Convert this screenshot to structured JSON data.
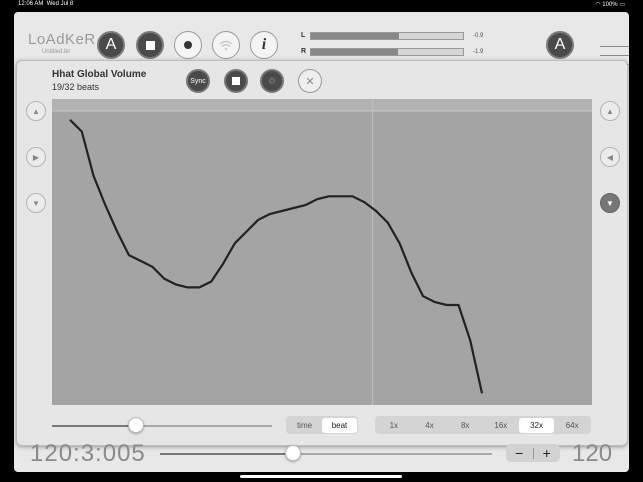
{
  "status_bar": {
    "time": "12:06 AM",
    "date": "Wed Jul 8",
    "battery": "100%"
  },
  "app": {
    "logo": "LoAdKeR",
    "file_name": "Untitled.lkr"
  },
  "toolbar": {
    "a_button": "A",
    "stop_icon": "stop-icon",
    "record_icon": "record-icon",
    "wifi_icon": "wifi-icon",
    "info_label": "i",
    "right_a_button": "A"
  },
  "meters": {
    "left": {
      "label": "L",
      "db": "-0.9",
      "level": 0.58
    },
    "right": {
      "label": "R",
      "db": "-1.9",
      "level": 0.57
    }
  },
  "panel": {
    "title": "Hhat Global Volume",
    "subtitle": "19/32 beats",
    "sync_label": "Sync",
    "stop_icon": "stop-icon",
    "recycle_icon": "recycle-icon",
    "close_icon": "close-icon",
    "left_buttons": [
      "up-arrow-icon",
      "play-arrow-icon",
      "down-arrow-icon"
    ],
    "right_buttons": [
      "up-arrow-icon",
      "left-arrow-icon",
      "down-arrow-icon"
    ]
  },
  "chart_data": {
    "type": "line",
    "x": [
      0,
      1,
      2,
      3,
      4,
      5,
      6,
      7,
      8,
      9,
      10,
      11,
      12,
      13,
      14,
      15,
      16,
      17,
      18,
      19,
      20,
      21,
      22,
      23,
      24,
      25,
      26,
      27,
      28,
      29,
      30,
      31,
      32,
      33,
      34,
      35
    ],
    "y": [
      0.97,
      0.93,
      0.78,
      0.68,
      0.59,
      0.51,
      0.49,
      0.47,
      0.43,
      0.41,
      0.4,
      0.4,
      0.42,
      0.48,
      0.55,
      0.59,
      0.63,
      0.65,
      0.66,
      0.67,
      0.68,
      0.7,
      0.71,
      0.71,
      0.71,
      0.69,
      0.66,
      0.62,
      0.55,
      0.45,
      0.37,
      0.35,
      0.34,
      0.34,
      0.22,
      0.04
    ],
    "playhead_beat": 19,
    "total_beats": 32,
    "grid": false
  },
  "controls": {
    "slider_value": 0.38,
    "mode_options": [
      "time",
      "beat"
    ],
    "mode_selected": "beat",
    "zoom_options": [
      "1x",
      "4x",
      "8x",
      "16x",
      "32x",
      "64x"
    ],
    "zoom_selected": "32x"
  },
  "transport": {
    "position": "120:3:005",
    "progress": 0.4,
    "minus_label": "−",
    "plus_label": "+",
    "tempo": "120"
  },
  "colors": {
    "curve": "#222222",
    "plot_bg": "#a4a4a4",
    "button_dark": "#4a4a4a"
  }
}
